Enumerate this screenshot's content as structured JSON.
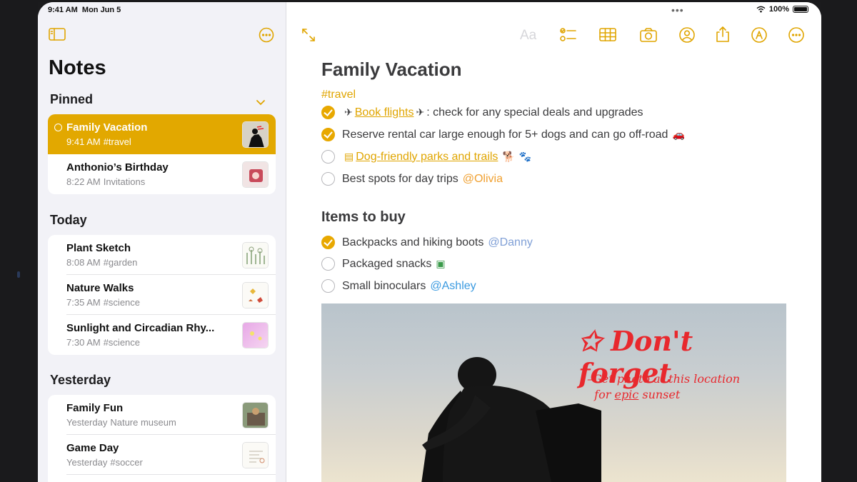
{
  "status": {
    "time": "9:41 AM",
    "date": "Mon Jun 5",
    "battery": "100%"
  },
  "sidebar": {
    "title": "Notes",
    "sections": [
      {
        "heading": "Pinned",
        "notes": [
          {
            "title": "Family Vacation",
            "time": "9:41 AM",
            "detail": "#travel",
            "selected": true
          },
          {
            "title": "Anthonio’s Birthday",
            "time": "8:22 AM",
            "detail": "Invitations"
          }
        ]
      },
      {
        "heading": "Today",
        "notes": [
          {
            "title": "Plant Sketch",
            "time": "8:08 AM",
            "detail": "#garden"
          },
          {
            "title": "Nature Walks",
            "time": "7:35 AM",
            "detail": "#science"
          },
          {
            "title": "Sunlight and Circadian Rhy...",
            "time": "7:30 AM",
            "detail": "#science"
          }
        ]
      },
      {
        "heading": "Yesterday",
        "notes": [
          {
            "title": "Family Fun",
            "time": "Yesterday",
            "detail": "Nature museum"
          },
          {
            "title": "Game Day",
            "time": "Yesterday",
            "detail": "#soccer"
          }
        ]
      }
    ]
  },
  "toolbar": {
    "format_label": "Aa"
  },
  "note": {
    "title": "Family Vacation",
    "tag": "#travel",
    "checklist": [
      {
        "checked": true,
        "link": "Book flights",
        "text": ": check for any special deals and upgrades"
      },
      {
        "checked": true,
        "text": "Reserve rental car large enough for 5+ dogs and can go off-road"
      },
      {
        "checked": false,
        "link": "Dog-friendly parks and trails"
      },
      {
        "checked": false,
        "text": "Best spots for day trips",
        "mention": "@Olivia"
      }
    ],
    "items_heading": "Items to buy",
    "items": [
      {
        "checked": true,
        "text": "Backpacks and hiking boots",
        "mention": "@Danny"
      },
      {
        "checked": false,
        "text": "Packaged snacks"
      },
      {
        "checked": false,
        "text": "Small binoculars",
        "mention": "@Ashley"
      }
    ],
    "handwriting": {
      "line1": "Don't forget",
      "line2": "–Get photo at this location",
      "line3_a": "for ",
      "line3_b": "epic",
      "line3_c": " sunset"
    }
  },
  "colors": {
    "accent": "#e0a500",
    "selected_row": "#e2a800",
    "handwriting": "#e8282d"
  }
}
